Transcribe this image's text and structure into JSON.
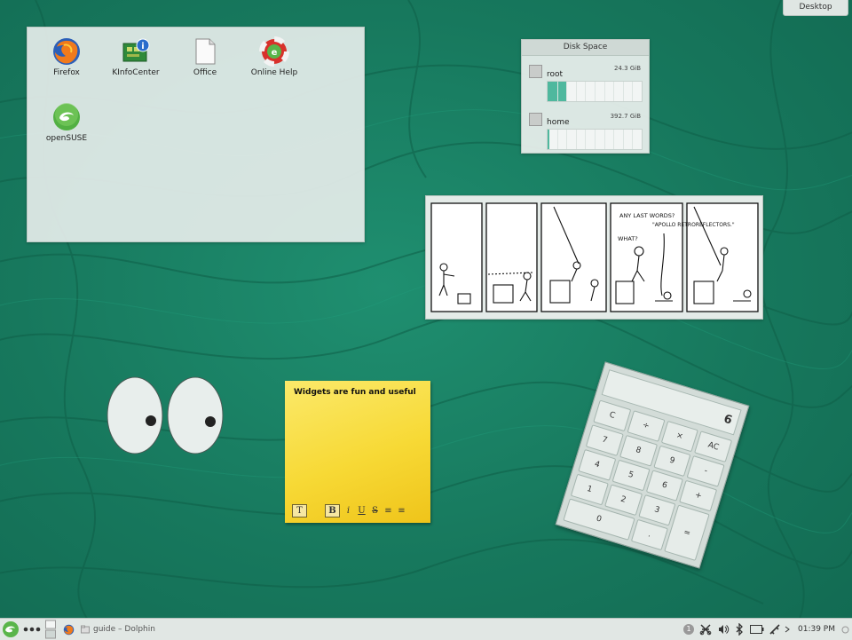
{
  "desktop": {
    "toolbox_label": "Desktop"
  },
  "folder_view": {
    "icons": [
      {
        "label": "Firefox",
        "icon": "firefox-icon"
      },
      {
        "label": "KInfoCenter",
        "icon": "kinfocenter-icon"
      },
      {
        "label": "Office",
        "icon": "office-document-icon"
      },
      {
        "label": "Online Help",
        "icon": "help-lifebuoy-icon"
      },
      {
        "label": "openSUSE",
        "icon": "opensuse-icon"
      }
    ]
  },
  "disk_space": {
    "title": "Disk Space",
    "entries": [
      {
        "name": "root",
        "size": "24.3 GiB",
        "usage_fraction": 0.2
      },
      {
        "name": "home",
        "size": "392.7 GiB",
        "usage_fraction": 0.02
      }
    ],
    "bar_color": "#4fb89e"
  },
  "comic": {
    "captions": [
      "ANY LAST WORDS?",
      "\"APOLLO RETROREFLECTORS.\"",
      "WHAT?"
    ]
  },
  "sticky_note": {
    "text": "Widgets are fun and useful",
    "tools": [
      "T",
      "B",
      "i",
      "U",
      "S",
      "≡",
      "≡"
    ]
  },
  "calculator": {
    "display": "6",
    "keys": [
      "C",
      "÷",
      "×",
      "AC",
      "7",
      "8",
      "9",
      "-",
      "4",
      "5",
      "6",
      "+",
      "1",
      "2",
      "3",
      "=",
      "0",
      "."
    ]
  },
  "panel": {
    "task_label": "guide – Dolphin",
    "notification_count": "1",
    "clock": "01:39 PM",
    "accent_color": "#59b54a"
  }
}
